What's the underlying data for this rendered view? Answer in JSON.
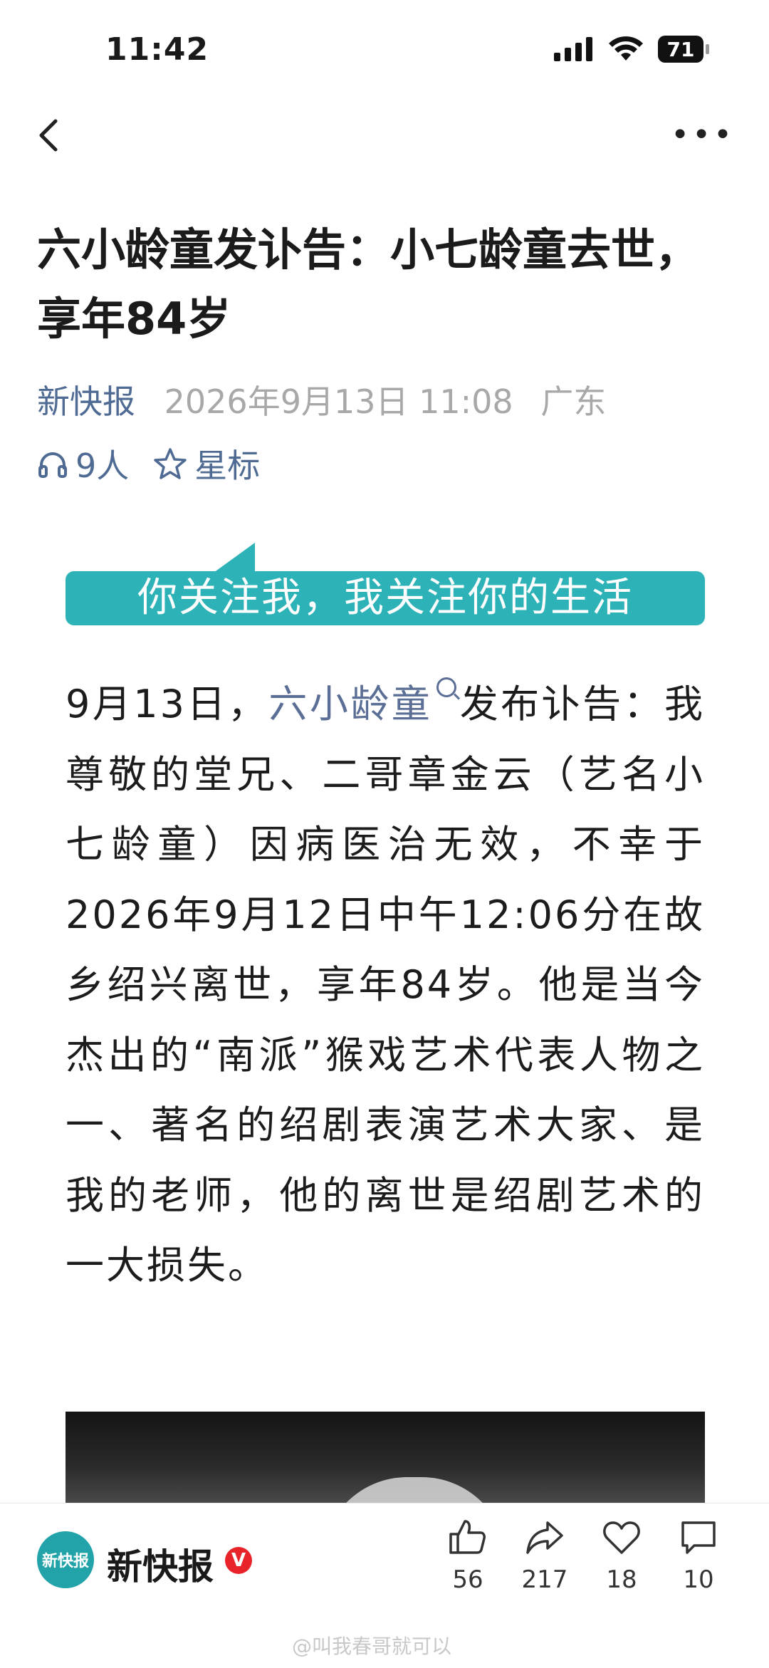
{
  "status_bar": {
    "time": "11:42",
    "battery": "71"
  },
  "nav": {
    "back_icon": "chevron-left-icon",
    "more_label": "•••"
  },
  "article": {
    "title": "六小龄童发讣告：小七龄童去世，享年84岁",
    "source": "新快报",
    "date": "2026年9月13日 11:08",
    "location": "广东",
    "listeners": "9人",
    "star_label": "星标",
    "banner": "你关注我，我关注你的生活",
    "body_lead": "9月13日，",
    "body_link": "六小龄童",
    "body_rest": "发布讣告：我尊敬的堂兄、二哥章金云（艺名小七龄童）因病医治无效，不幸于2026年9月12日中午12:06分在故乡绍兴离世，享年84岁。他是当今杰出的“南派”猴戏艺术代表人物之一、著名的绍剧表演艺术大家、是我的老师，他的离世是绍剧艺术的一大损失。"
  },
  "bottom_bar": {
    "logo_text": "新快报",
    "publisher": "新快报",
    "verified": "V",
    "actions": [
      {
        "icon": "thumbs-up-icon",
        "count": "56"
      },
      {
        "icon": "share-icon",
        "count": "217"
      },
      {
        "icon": "heart-icon",
        "count": "18"
      },
      {
        "icon": "comment-icon",
        "count": "10"
      }
    ]
  },
  "watermark": "@叫我春哥就可以",
  "colors": {
    "accent": "#2db3b7",
    "link": "#4f6b93",
    "verified": "#e8242a"
  }
}
